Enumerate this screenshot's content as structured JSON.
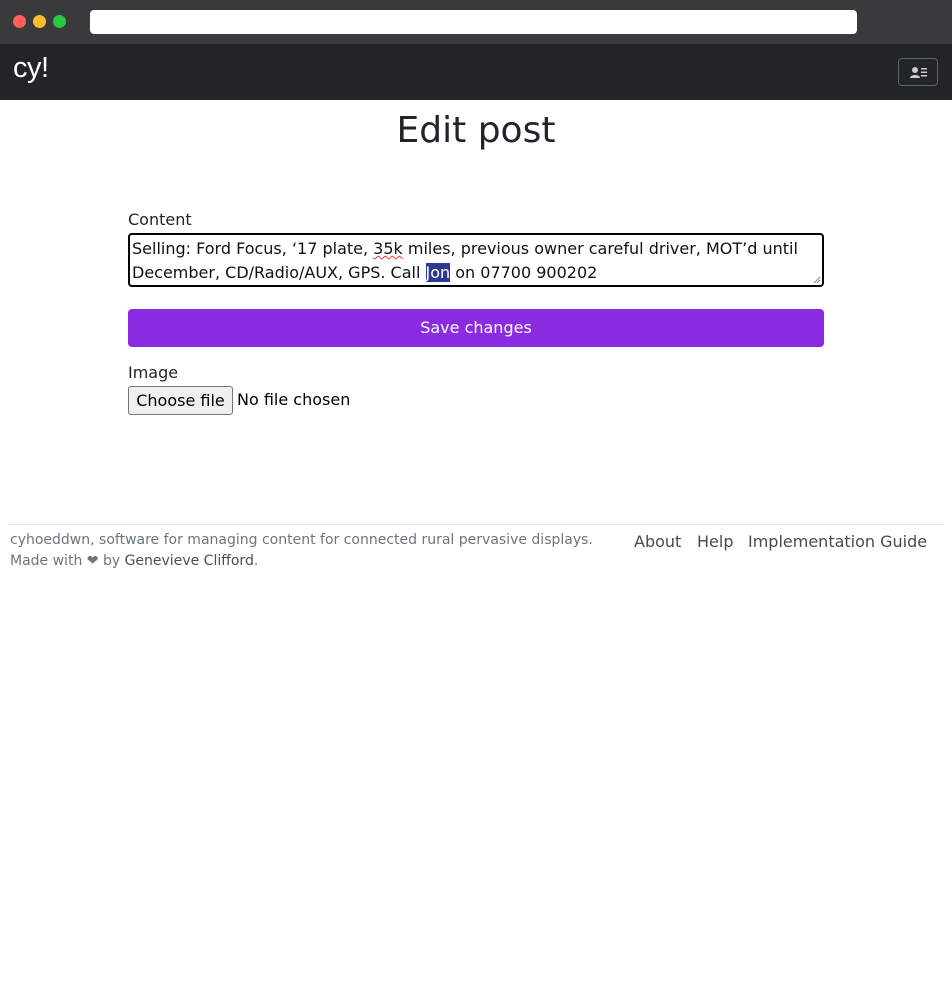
{
  "browser": {
    "url": ""
  },
  "navbar": {
    "brand": "cy!",
    "profile_icon": "user-card-icon"
  },
  "page": {
    "title": "Edit post"
  },
  "form": {
    "content_label": "Content",
    "content_value": {
      "part1": "Selling: Ford Focus, ‘17 plate, ",
      "typo_word": "35k",
      "part2": " miles, previous owner careful driver, MOT’d until December, CD/Radio/AUX, GPS. Call ",
      "selected_text": "Jon",
      "part3": " on 07700 900202"
    },
    "save_label": "Save changes",
    "image_label": "Image",
    "file_button_label": "Choose file",
    "file_status": "No file chosen"
  },
  "footer": {
    "description": "cyhoeddwn, software for managing content for connected rural pervasive displays.",
    "made_with_prefix": "Made with ❤ by ",
    "author": "Genevieve Clifford",
    "made_with_suffix": ".",
    "links": {
      "about": "About",
      "help": "Help",
      "guide": "Implementation Guide"
    }
  },
  "colors": {
    "navbar_bg": "#212529",
    "primary_button": "#8a2be2",
    "selection": "#2f3a8f"
  }
}
